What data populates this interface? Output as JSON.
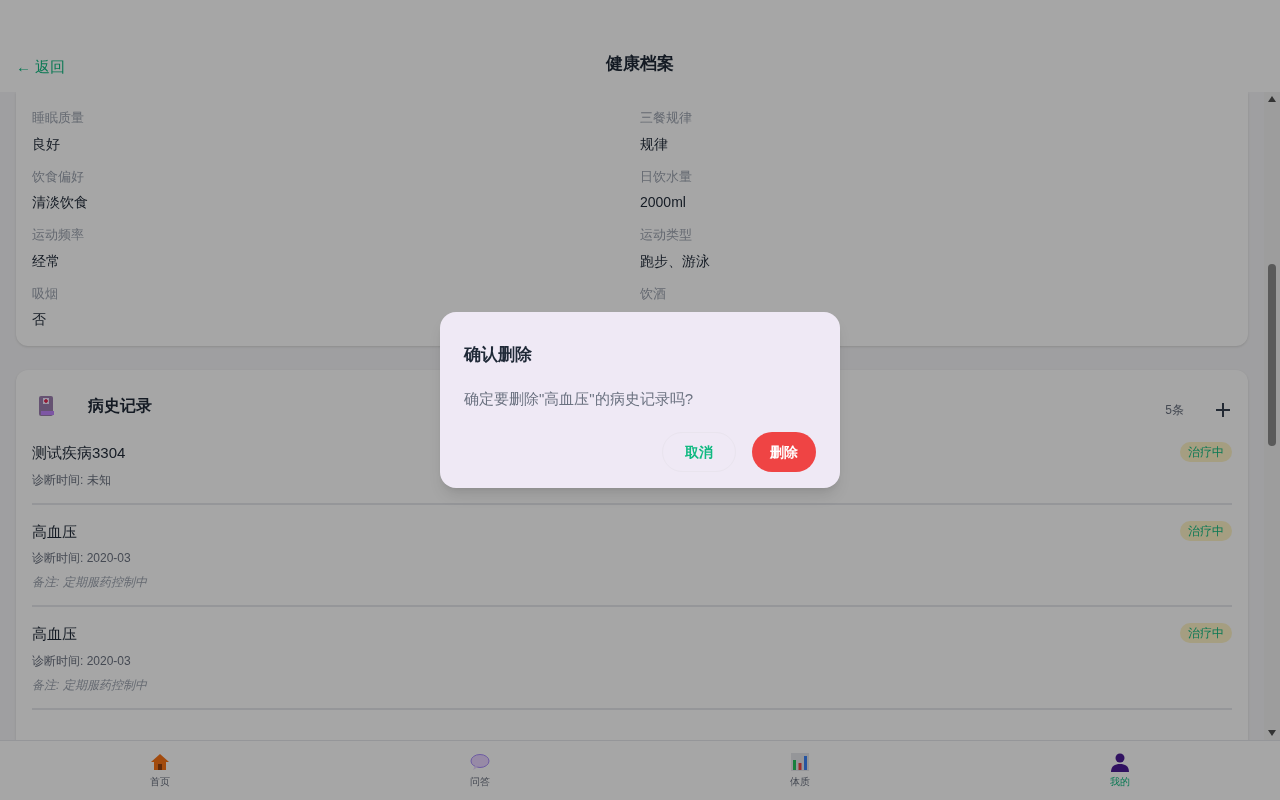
{
  "header": {
    "back": "← 返回",
    "title": "健康档案"
  },
  "lifestyle": [
    {
      "label": "睡眠质量",
      "value": "良好"
    },
    {
      "label": "三餐规律",
      "value": "规律"
    },
    {
      "label": "饮食偏好",
      "value": "清淡饮食"
    },
    {
      "label": "日饮水量",
      "value": "2000ml"
    },
    {
      "label": "运动频率",
      "value": "经常"
    },
    {
      "label": "运动类型",
      "value": "跑步、游泳"
    },
    {
      "label": "吸烟",
      "value": "否"
    },
    {
      "label": "饮酒"
    }
  ],
  "history": {
    "title": "病史记录",
    "count": "5条",
    "records": [
      {
        "name": "测试疾病3304",
        "date": "诊断时间: 未知",
        "status": "治疗中"
      },
      {
        "name": "高血压",
        "date": "诊断时间: 2020-03",
        "note": "备注: 定期服药控制中",
        "status": "治疗中"
      },
      {
        "name": "高血压",
        "date": "诊断时间: 2020-03",
        "note": "备注: 定期服药控制中",
        "status": "治疗中"
      }
    ]
  },
  "dialog": {
    "title": "确认删除",
    "message": "确定要删除\"高血压\"的病史记录吗?",
    "cancel": "取消",
    "confirm": "删除"
  },
  "tab_bar": [
    {
      "label": "首页",
      "kind": "home",
      "selected": false
    },
    {
      "label": "问答",
      "kind": "chat",
      "selected": false
    },
    {
      "label": "体质",
      "kind": "chart",
      "selected": false
    },
    {
      "label": "我的",
      "kind": "profile",
      "selected": true
    }
  ]
}
